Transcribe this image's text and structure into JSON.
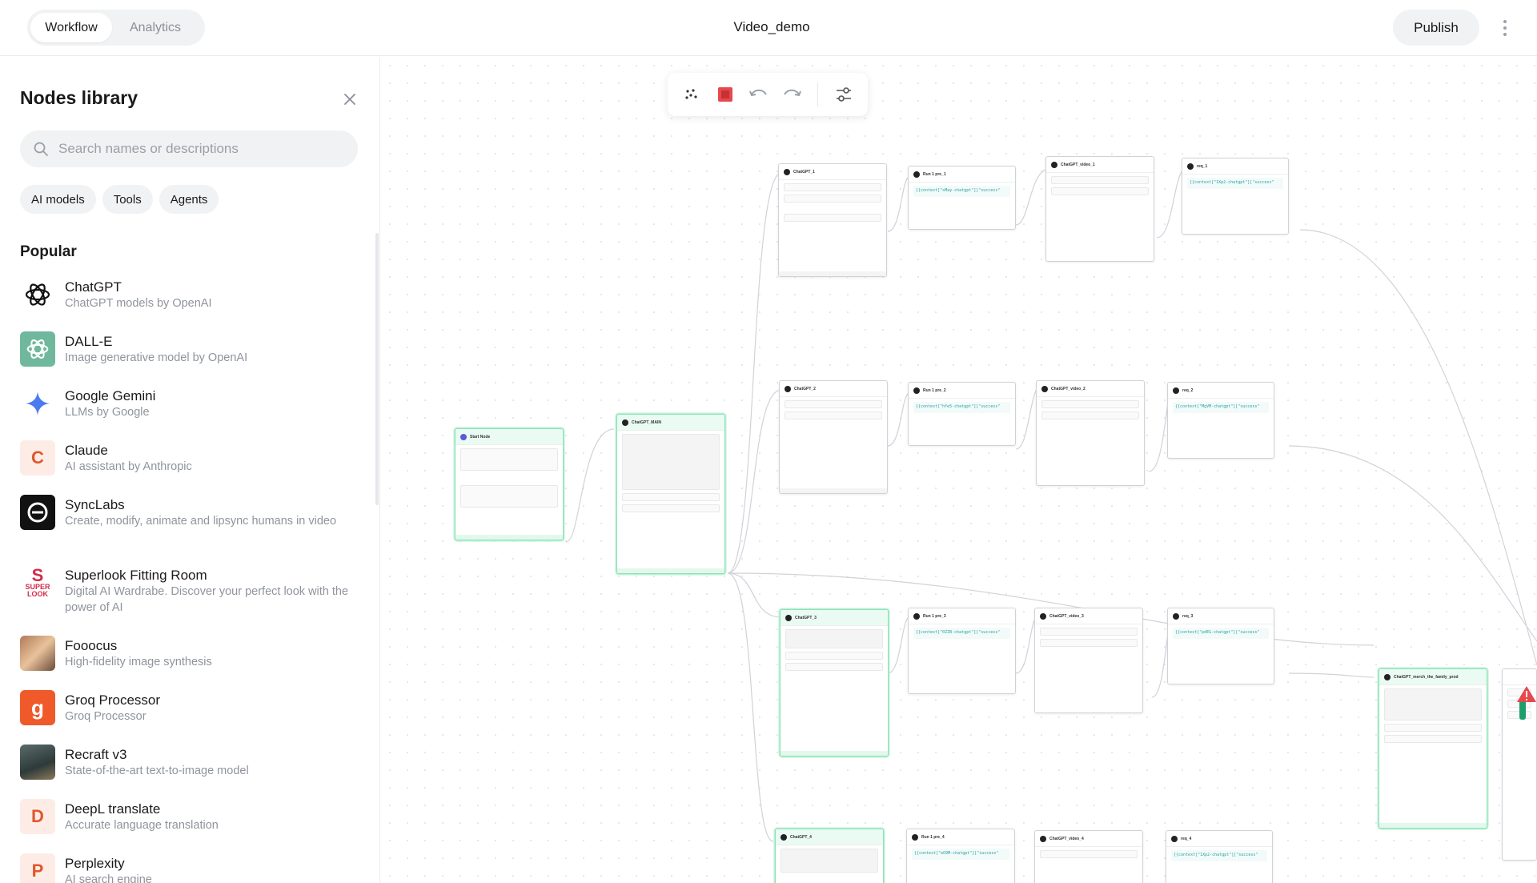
{
  "topbar": {
    "tabs": [
      {
        "label": "Workflow",
        "active": true
      },
      {
        "label": "Analytics",
        "active": false
      }
    ],
    "title": "Video_demo",
    "publish_label": "Publish"
  },
  "sidebar": {
    "title": "Nodes library",
    "search_placeholder": "Search names or descriptions",
    "filters": [
      "AI models",
      "Tools",
      "Agents"
    ],
    "section": "Popular",
    "items": [
      {
        "name": "ChatGPT",
        "desc": "ChatGPT models by OpenAI",
        "icon": "openai-icon"
      },
      {
        "name": "DALL-E",
        "desc": "Image generative model by OpenAI",
        "icon": "dalle-icon"
      },
      {
        "name": "Google Gemini",
        "desc": "LLMs by Google",
        "icon": "gemini-icon"
      },
      {
        "name": "Claude",
        "desc": "AI assistant by Anthropic",
        "icon": "claude-icon"
      },
      {
        "name": "SyncLabs",
        "desc": "Create, modify, animate and lipsync humans in video",
        "icon": "synclabs-icon"
      },
      {
        "name": "Superlook Fitting Room",
        "desc": "Digital AI Wardrabe. Discover your perfect look with the power of AI",
        "icon": "superlook-icon"
      },
      {
        "name": "Fooocus",
        "desc": "High-fidelity image synthesis",
        "icon": "fooocus-icon"
      },
      {
        "name": "Groq Processor",
        "desc": "Groq Processor",
        "icon": "groq-icon"
      },
      {
        "name": "Recraft v3",
        "desc": "State-of-the-art text-to-image model",
        "icon": "recraft-icon"
      },
      {
        "name": "DeepL translate",
        "desc": "Accurate language translation",
        "icon": "deepl-icon"
      },
      {
        "name": "Perplexity",
        "desc": "AI search engine",
        "icon": "perplexity-icon"
      }
    ]
  },
  "canvas": {
    "nodes": [
      {
        "title": "Start Node",
        "green": true
      },
      {
        "title": "ChatGPT_MAIN",
        "green": true
      },
      {
        "title": "ChatGPT_1",
        "green": false
      },
      {
        "title": "Run 1 pre_1",
        "green": false,
        "code": "{{context[\"sMay-chatgpt\"][\"success\""
      },
      {
        "title": "ChatGPT_video_1",
        "green": false
      },
      {
        "title": "req_1",
        "green": false,
        "code": "{{context[\"1Xp2-chatgpt\"][\"success\""
      },
      {
        "title": "ChatGPT_2",
        "green": false
      },
      {
        "title": "Run 1 pre_2",
        "green": false,
        "code": "{{context[\"hfe5-chatgpt\"][\"success\""
      },
      {
        "title": "ChatGPT_video_2",
        "green": false
      },
      {
        "title": "req_2",
        "green": false,
        "code": "{{context[\"MgVM-chatgpt\"][\"success\""
      },
      {
        "title": "ChatGPT_3",
        "green": true
      },
      {
        "title": "Run 1 pre_3",
        "green": false,
        "code": "{{context[\"0ZZB-chatgpt\"][\"success\""
      },
      {
        "title": "ChatGPT_video_3",
        "green": false
      },
      {
        "title": "req_3",
        "green": false,
        "code": "{{context[\"pdEG-chatgpt\"][\"success\""
      },
      {
        "title": "ChatGPT_4",
        "green": true
      },
      {
        "title": "Run 1 pre_4",
        "green": false,
        "code": "{{context[\"eO9M-chatgpt\"][\"success\""
      },
      {
        "title": "ChatGPT_video_4",
        "green": false
      },
      {
        "title": "req_4",
        "green": false,
        "code": "{{context[\"1Xp2-chatgpt\"][\"success\""
      },
      {
        "title": "ChatGPT_merch_the_family_prod",
        "green": true
      }
    ]
  },
  "colors": {
    "accent_red": "#e5484d",
    "node_green": "#8fe0b7"
  }
}
